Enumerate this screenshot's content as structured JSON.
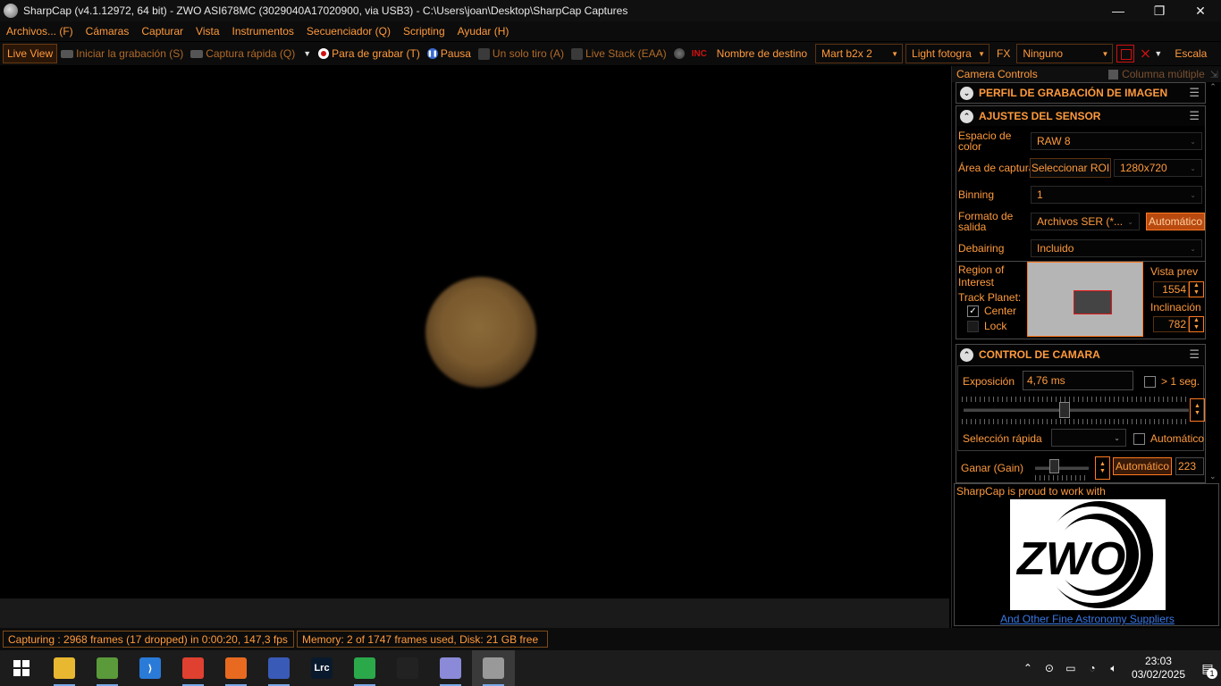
{
  "window": {
    "title": "SharpCap (v4.1.12972, 64 bit) - ZWO ASI678MC (3029040A17020900, via USB3) - C:\\Users\\joan\\Desktop\\SharpCap Captures",
    "minimize": "—",
    "maximize": "❐",
    "close": "✕"
  },
  "menu": [
    "Archivos... (F)",
    "Cámaras",
    "Capturar",
    "Vista",
    "Instrumentos",
    "Secuenciador (Q)",
    "Scripting",
    "Ayudar (H)"
  ],
  "toolbar": {
    "live_view": "Live View",
    "start_recording": "Iniciar la grabación (S)",
    "quick_capture": "Captura rápida (Q)",
    "stop_recording": "Para de grabar (T)",
    "pause": "Pausa",
    "single_shot": "Un solo tiro (A)",
    "live_stack": "Live Stack (EAA)",
    "inc_icon": "INC",
    "target_label": "Nombre de destino",
    "target_value": "Mart b2x 2",
    "frame_type_value": "Light fotogra",
    "fx_label": "FX",
    "fx_value": "Ninguno",
    "scale_label": "Escala"
  },
  "panel": {
    "header": "Camera Controls",
    "multi_column": "Columna múltiple",
    "pin": "⇲",
    "section_profile": "PERFIL DE GRABACIÓN DE IMAGEN",
    "section_sensor": "AJUSTES DEL SENSOR",
    "color_space_label": "Espacio de color",
    "color_space_value": "RAW 8",
    "capture_area_label": "Área de captura",
    "select_roi": "Seleccionar ROI",
    "capture_area_value": "1280x720",
    "binning_label": "Binning",
    "binning_value": "1",
    "output_format_label": "Formato de salida",
    "output_format_value": "Archivos SER (*...",
    "output_format_auto": "Automático",
    "debayer_label": "Debairing",
    "debayer_value": "Incluido",
    "roi_label": "Region of Interest",
    "track_planet_label": "Track Planet:",
    "center_label": "Center",
    "lock_label": "Lock",
    "preview_label": "Vista prev",
    "preview_value": "1554",
    "tilt_label": "Inclinación",
    "tilt_value": "782",
    "section_camera": "CONTROL DE CAMARA",
    "exposure_label": "Exposición",
    "exposure_value": "4,76 ms",
    "over_1s_label": "> 1 seg.",
    "quick_select_label": "Selección rápida",
    "quick_select_value": "",
    "quick_auto_label": "Automático",
    "gain_label": "Ganar (Gain)",
    "gain_auto": "Automático",
    "gain_value": "223",
    "exposure_slider_level": 0.45,
    "gain_slider_level": 0.35
  },
  "sponsor": {
    "text": "SharpCap is proud to work with",
    "logo_text": "ZWO",
    "link": "And Other Fine Astronomy Suppliers"
  },
  "status": {
    "capturing": "Capturing : 2968 frames (17 dropped) in 0:00:20, 147,3 fps",
    "memory": "Memory: 2 of 1747 frames used, Disk: 21 GB free"
  },
  "taskbar": {
    "apps": [
      {
        "name": "file-explorer",
        "glyph": "",
        "color": "#e8b830"
      },
      {
        "name": "notepad-app",
        "glyph": "",
        "color": "#5a9a3a"
      },
      {
        "name": "vscode",
        "glyph": "⟩",
        "color": "#2a7ad8"
      },
      {
        "name": "chrome",
        "glyph": "",
        "color": "#e04030"
      },
      {
        "name": "firefox",
        "glyph": "",
        "color": "#e86a20"
      },
      {
        "name": "network-app",
        "glyph": "",
        "color": "#3a5ab8"
      },
      {
        "name": "lightroom",
        "glyph": "Lrc",
        "color": "#0a1a2e"
      },
      {
        "name": "media-app",
        "glyph": "",
        "color": "#2aa84a"
      },
      {
        "name": "astro-app",
        "glyph": "",
        "color": "#222"
      },
      {
        "name": "paint-app",
        "glyph": "",
        "color": "#8a8ad8"
      },
      {
        "name": "sharpcap-app",
        "glyph": "",
        "color": "#999"
      }
    ],
    "time": "23:03",
    "date": "03/02/2025",
    "notifications": "1"
  }
}
